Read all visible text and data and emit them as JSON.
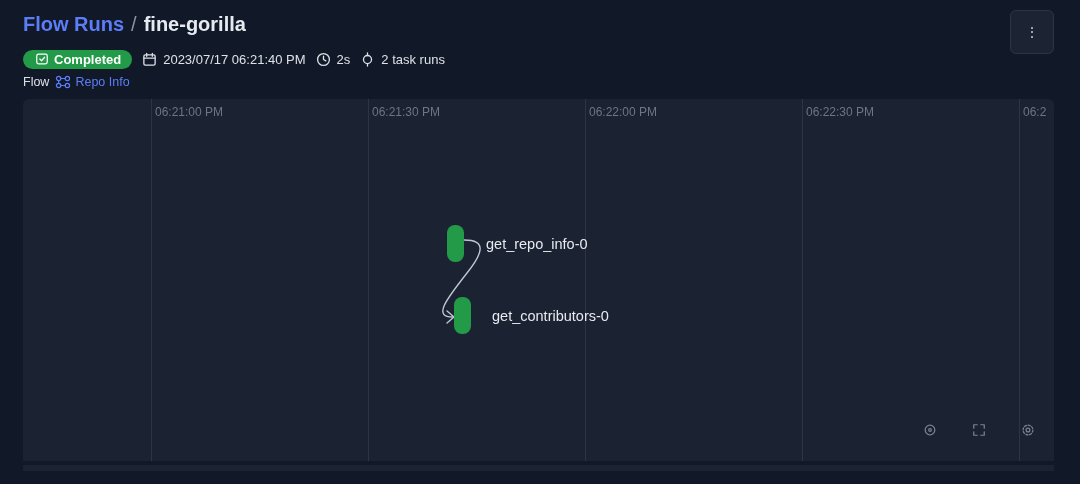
{
  "breadcrumb": {
    "parent": "Flow Runs",
    "separator": "/",
    "current": "fine-gorilla"
  },
  "menu_button": {
    "label": "⋮"
  },
  "status": {
    "label": "Completed"
  },
  "meta": [
    {
      "kind": "calendar",
      "text": "2023/07/17 06:21:40 PM"
    },
    {
      "kind": "clock",
      "text": "2s"
    },
    {
      "kind": "task",
      "text": "2 task runs"
    }
  ],
  "flow": {
    "label": "Flow",
    "link": "Repo Info"
  },
  "timeline": {
    "ticks": [
      "06:21:00 PM",
      "06:21:30 PM",
      "06:22:00 PM",
      "06:22:30 PM",
      "06:2"
    ],
    "nodes": [
      {
        "label": "get_repo_info-0"
      },
      {
        "label": "get_contributors-0"
      }
    ],
    "controls": [
      {
        "kind": "recenter"
      },
      {
        "kind": "expand"
      },
      {
        "kind": "settings"
      }
    ]
  }
}
